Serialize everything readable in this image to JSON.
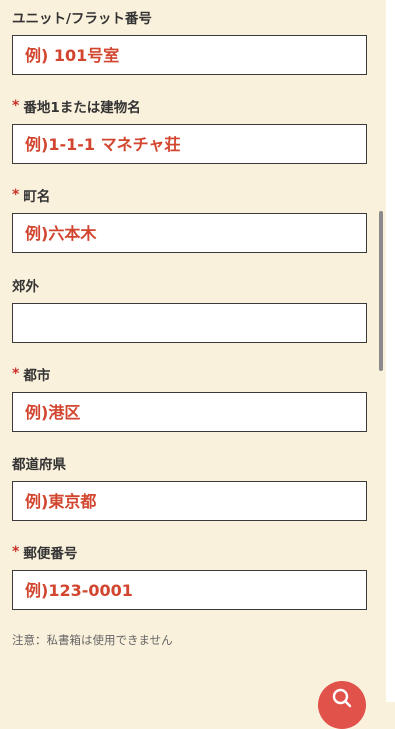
{
  "form": {
    "unit": {
      "label": "ユニット/フラット番号",
      "required": false,
      "value": "",
      "placeholder": "例) 101号室"
    },
    "address1": {
      "label": "番地1または建物名",
      "required": true,
      "value": "",
      "placeholder": "例)1-1-1 マネチャ荘"
    },
    "town": {
      "label": "町名",
      "required": true,
      "value": "",
      "placeholder": "例)六本木"
    },
    "suburb": {
      "label": "郊外",
      "required": false,
      "value": "",
      "placeholder": ""
    },
    "city": {
      "label": "都市",
      "required": true,
      "value": "",
      "placeholder": "例)港区"
    },
    "prefecture": {
      "label": "都道府県",
      "required": false,
      "value": "",
      "placeholder": "例)東京都"
    },
    "postal_code": {
      "label": "郵便番号",
      "required": true,
      "value": "",
      "placeholder": "例)123-0001"
    },
    "required_marker": "*",
    "note": "注意：私書箱は使用できません"
  },
  "colors": {
    "background": "#faf1dc",
    "required_marker": "#c8302a",
    "placeholder": "#d2452f",
    "help_button": "#e0524a"
  },
  "icons": {
    "help_button": "search-icon"
  }
}
